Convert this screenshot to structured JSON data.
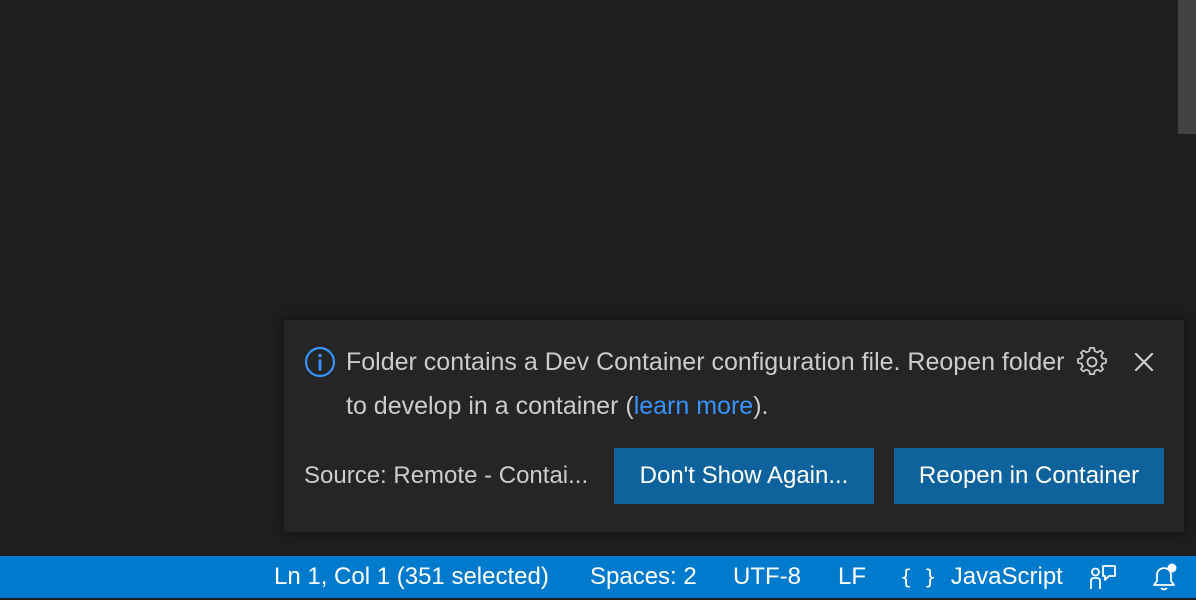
{
  "notification": {
    "message_before_link": "Folder contains a Dev Container configuration file. Reopen folder to develop in a container (",
    "link_text": "learn more",
    "message_after_link": ").",
    "source": "Source: Remote - Contai...",
    "buttons": {
      "dont_show_again": "Don't Show Again...",
      "reopen_in_container": "Reopen in Container"
    },
    "icons": {
      "info": "info-icon",
      "settings": "gear-icon",
      "close": "close-icon"
    }
  },
  "status_bar": {
    "cursor_position": "Ln 1, Col 1 (351 selected)",
    "indentation": "Spaces: 2",
    "encoding": "UTF-8",
    "line_ending": "LF",
    "language_braces": "{ }",
    "language": "JavaScript",
    "icons": {
      "feedback": "feedback-icon",
      "notifications": "bell-icon"
    }
  },
  "colors": {
    "accent": "#007acc",
    "button": "#0e639c",
    "link": "#3794ff",
    "editor_background": "#1e1e1e",
    "notification_background": "#252526"
  }
}
